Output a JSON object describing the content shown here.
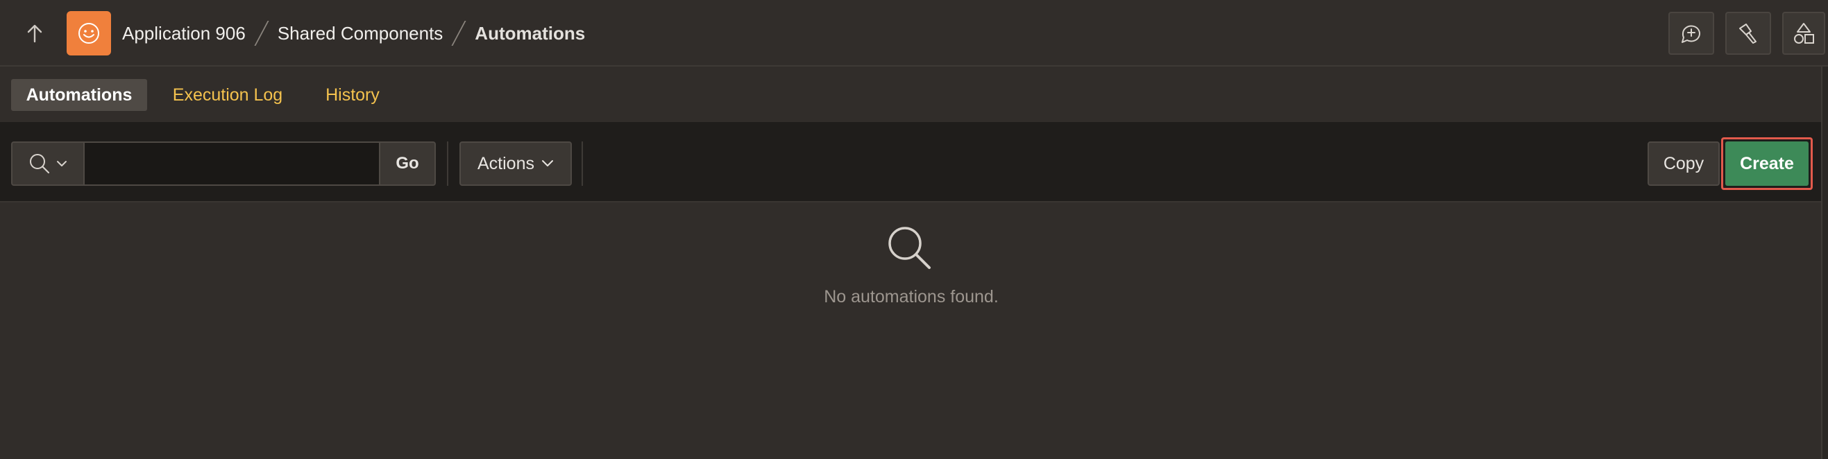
{
  "header": {
    "up_icon": "arrow-up-icon",
    "app_icon": "smiley-app-icon",
    "brand_color": "#f0803c",
    "breadcrumb": [
      "Application 906",
      "Shared Components",
      "Automations"
    ],
    "tools": [
      "add-comment-icon",
      "flashlight-icon",
      "shapes-icon"
    ]
  },
  "tabs": [
    {
      "label": "Automations",
      "active": true
    },
    {
      "label": "Execution Log",
      "active": false
    },
    {
      "label": "History",
      "active": false
    }
  ],
  "toolbar": {
    "search_icon": "search-icon",
    "search_value": "",
    "go_label": "Go",
    "actions_label": "Actions",
    "copy_label": "Copy",
    "create_label": "Create",
    "create_color": "#3d8a58",
    "highlight_color": "#e25a4c"
  },
  "empty_state": {
    "icon": "search-icon",
    "message": "No automations found."
  },
  "colors": {
    "background": "#312d2a",
    "toolbar": "#1f1d1b",
    "tab_link": "#f4c24e"
  }
}
